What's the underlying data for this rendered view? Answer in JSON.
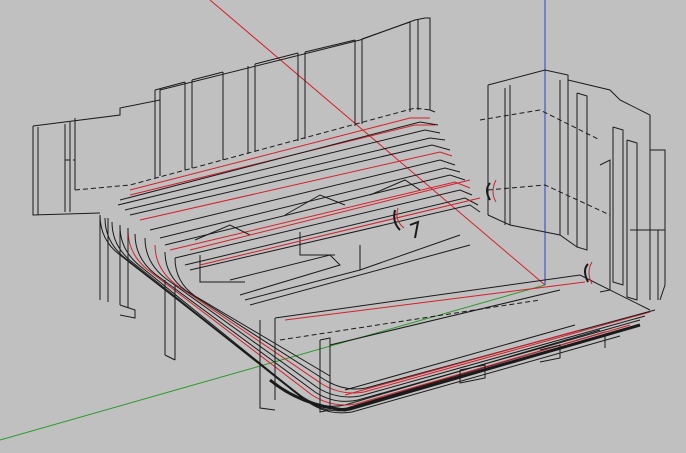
{
  "viewport": {
    "background": "#c0c0c0",
    "axes": {
      "x_axis_color": "#d4202a",
      "y_axis_color": "#2a9a2a",
      "z_axis_color": "#2b3fd0"
    },
    "model": {
      "line_color": "#1a1a1a",
      "highlight_color": "#d4202a",
      "render_style": "wireframe"
    }
  }
}
